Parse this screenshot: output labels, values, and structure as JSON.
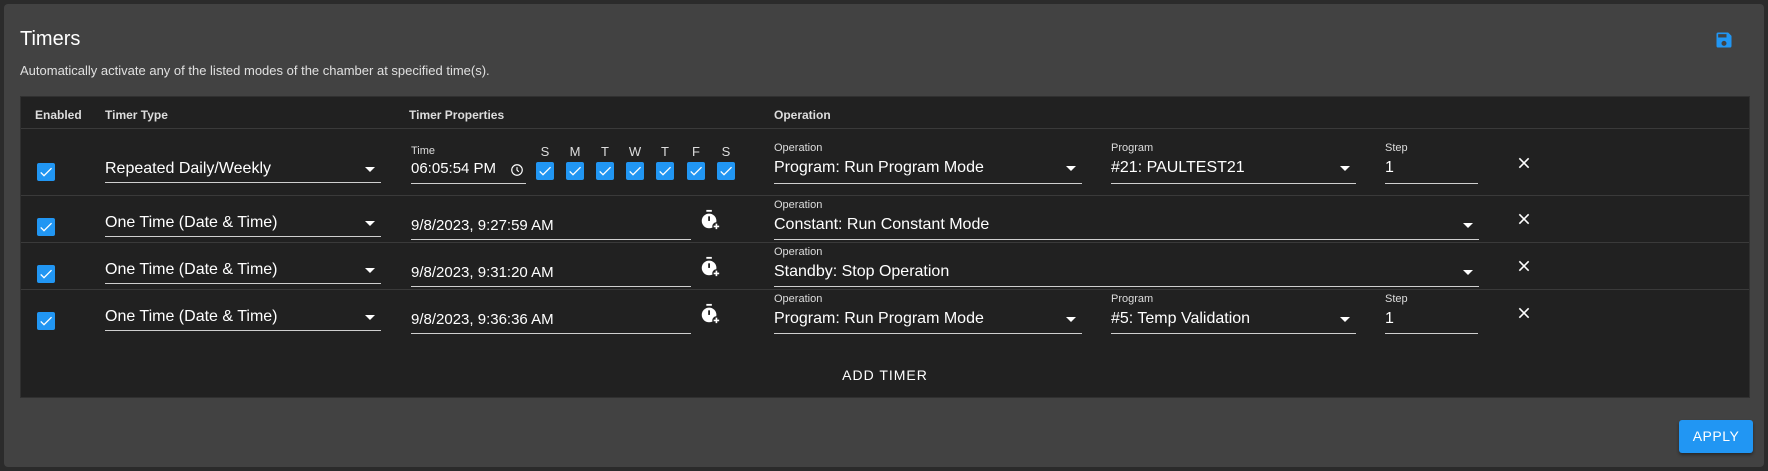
{
  "panel": {
    "title": "Timers",
    "subtitle": "Automatically activate any of the listed modes of the chamber at specified time(s)."
  },
  "table": {
    "headers": {
      "enabled": "Enabled",
      "timer_type": "Timer Type",
      "timer_properties": "Timer Properties",
      "operation": "Operation"
    },
    "labels": {
      "time": "Time",
      "operation": "Operation",
      "program": "Program",
      "step": "Step"
    },
    "days": [
      "S",
      "M",
      "T",
      "W",
      "T",
      "F",
      "S"
    ],
    "rows": [
      {
        "enabled": true,
        "timer_type": "Repeated Daily/Weekly",
        "time": "06:05:54 PM",
        "operation": "Program: Run Program Mode",
        "program": "#21: PAULTEST21",
        "step": "1"
      },
      {
        "enabled": true,
        "timer_type": "One Time (Date & Time)",
        "datetime": "9/8/2023, 9:27:59 AM",
        "operation": "Constant: Run Constant Mode"
      },
      {
        "enabled": true,
        "timer_type": "One Time (Date & Time)",
        "datetime": "9/8/2023, 9:31:20 AM",
        "operation": "Standby: Stop Operation"
      },
      {
        "enabled": true,
        "timer_type": "One Time (Date & Time)",
        "datetime": "9/8/2023, 9:36:36 AM",
        "operation": "Program: Run Program Mode",
        "program": "#5: Temp Validation",
        "step": "1"
      }
    ],
    "add_label": "ADD TIMER"
  },
  "footer": {
    "apply_label": "APPLY"
  },
  "colors": {
    "accent": "#2196f3",
    "panel": "#424242",
    "table": "#212121"
  },
  "icons": {
    "save": "floppy-disk-icon",
    "clock": "clock-icon",
    "timer": "timer-add-icon",
    "close": "close-icon",
    "check": "checkmark-icon",
    "caret": "caret-down-icon"
  }
}
